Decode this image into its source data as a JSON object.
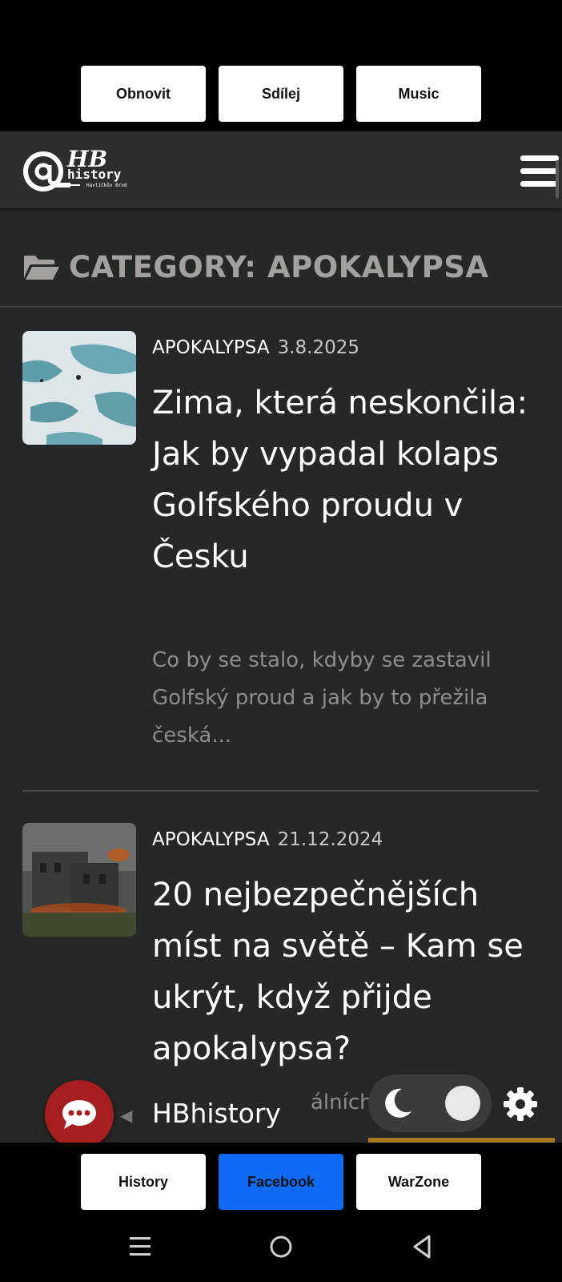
{
  "top_buttons": [
    "Obnovit",
    "Sdílej",
    "Music"
  ],
  "header": {
    "logo_main": "HB",
    "logo_sub": "history",
    "logo_tag": "Havlíčkův Brod"
  },
  "category": {
    "title": "CATEGORY: APOKALYPSA"
  },
  "posts": [
    {
      "category": "APOKALYPSA",
      "date": "3.8.2025",
      "title": "Zima, která neskončila: Jak by vypadal kolaps Golfského proudu v Česku",
      "excerpt": "Co by se stalo, kdyby se zastavil Golfský proud a jak by to přežila česká..."
    },
    {
      "category": "APOKALYPSA",
      "date": "21.12.2024",
      "title": "20 nejbezpečnějších míst na světě – Kam se ukrýt, když přijde apokalypsa?",
      "excerpt_visible": "álních"
    }
  ],
  "chat_widget": {
    "label": "HBhistory"
  },
  "bottom_buttons": [
    "History",
    "Facebook",
    "WarZone"
  ],
  "colors": {
    "page_bg": "#262727",
    "accent_chat": "#a61e1e",
    "facebook_button": "#0f6bf5",
    "category_heading": "#a3a19e"
  }
}
